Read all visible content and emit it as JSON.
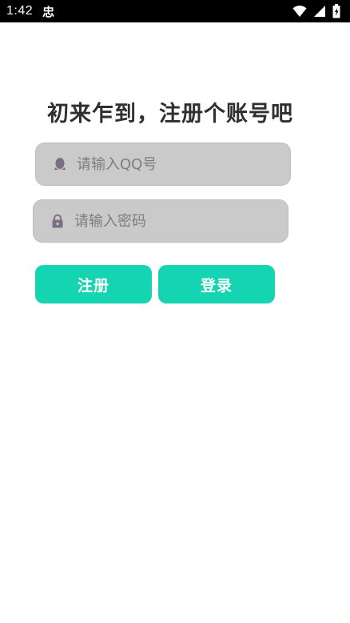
{
  "status_bar": {
    "time": "1:42",
    "app_glyph": "忠",
    "icons": [
      "wifi-icon",
      "signal-icon",
      "battery-icon"
    ]
  },
  "title": "初来乍到，注册个账号吧",
  "form": {
    "qq": {
      "placeholder": "请输入QQ号",
      "value": "",
      "icon": "qq-penguin-icon"
    },
    "password": {
      "placeholder": "请输入密码",
      "value": "",
      "icon": "lock-icon"
    }
  },
  "buttons": {
    "register": "注册",
    "login": "登录"
  },
  "colors": {
    "accent": "#15d4b2",
    "field_bg": "#cacaca",
    "icon": "#7b6f86",
    "title": "#2f2f2f"
  }
}
